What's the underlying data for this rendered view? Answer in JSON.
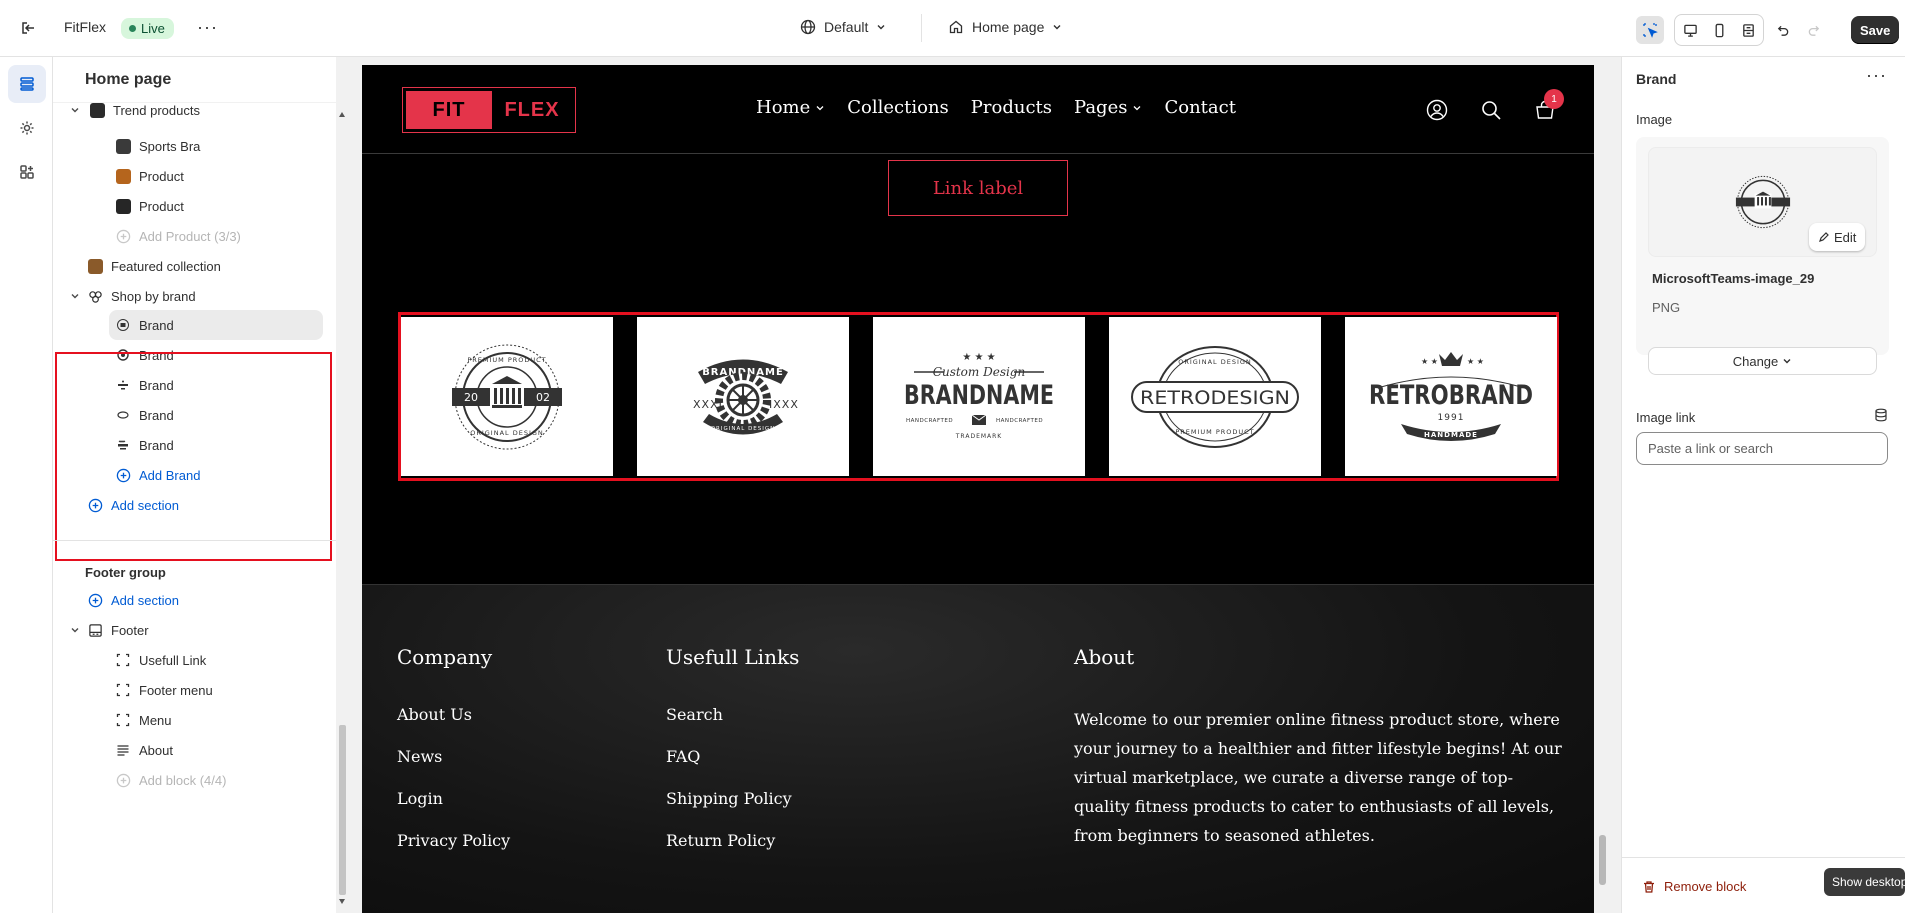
{
  "topbar": {
    "store_name": "FitFlex",
    "status_badge": "Live",
    "theme_label": "Default",
    "page_label": "Home page",
    "save_label": "Save"
  },
  "left_panel": {
    "title": "Home page",
    "items": {
      "trend_products": "Trend products",
      "sports_bra": "Sports Bra",
      "product_1": "Product",
      "product_2": "Product",
      "add_product": "Add Product (3/3)",
      "featured_collection": "Featured collection",
      "shop_by_brand": "Shop by brand",
      "brand_1": "Brand",
      "brand_2": "Brand",
      "brand_3": "Brand",
      "brand_4": "Brand",
      "brand_5": "Brand",
      "add_brand": "Add Brand",
      "add_section_1": "Add section",
      "footer_group": "Footer group",
      "add_section_2": "Add section",
      "footer": "Footer",
      "usefull_link": "Usefull Link",
      "footer_menu": "Footer menu",
      "menu": "Menu",
      "about": "About",
      "add_block": "Add block (4/4)"
    }
  },
  "preview": {
    "logo": {
      "part1": "FIT",
      "part2": "FLEX"
    },
    "nav": [
      "Home",
      "Collections",
      "Products",
      "Pages",
      "Contact"
    ],
    "cart_count": "1",
    "link_label": "Link label",
    "brand_logos": [
      {
        "top": "PREMIUM PRODUCT",
        "left": "20",
        "right": "02",
        "bottom": "ORIGINAL DESIGN"
      },
      {
        "top": "BRANDNAME",
        "left": "XXXI",
        "right": "IXXX",
        "bottom": "ORIGINAL DESIGN"
      },
      {
        "script": "Custom Design",
        "main": "BRANDNAME",
        "left": "HANDCRAFTED",
        "right": "HANDCRAFTED",
        "bottom": "TRADEMARK"
      },
      {
        "top": "ORIGINAL DESIGN",
        "main": "RETRODESIGN",
        "bottom": "PREMIUM PRODUCT"
      },
      {
        "main": "RETROBRAND",
        "year": "1991",
        "bottom": "HANDMADE"
      }
    ],
    "footer": {
      "company_heading": "Company",
      "company_links": [
        "About Us",
        "News",
        "Login",
        "Privacy Policy"
      ],
      "useful_heading": "Usefull Links",
      "useful_links": [
        "Search",
        "FAQ",
        "Shipping Policy",
        "Return Policy"
      ],
      "about_heading": "About",
      "about_text": "Welcome to our premier online fitness product store, where your journey to a healthier and fitter lifestyle begins! At our virtual marketplace, we curate a diverse range of top-quality fitness products to cater to enthusiasts of all levels, from beginners to seasoned athletes."
    }
  },
  "right_panel": {
    "title": "Brand",
    "image_label": "Image",
    "edit_label": "Edit",
    "image_name": "MicrosoftTeams-image_29",
    "image_type": "PNG",
    "change_label": "Change",
    "image_link_label": "Image link",
    "link_placeholder": "Paste a link or search",
    "remove_label": "Remove block",
    "tooltip": "Show desktop"
  },
  "colors": {
    "accent_red": "#e4344a",
    "highlight_red": "#e5101f",
    "link_blue": "#005bd3",
    "save_dark": "#303030"
  }
}
